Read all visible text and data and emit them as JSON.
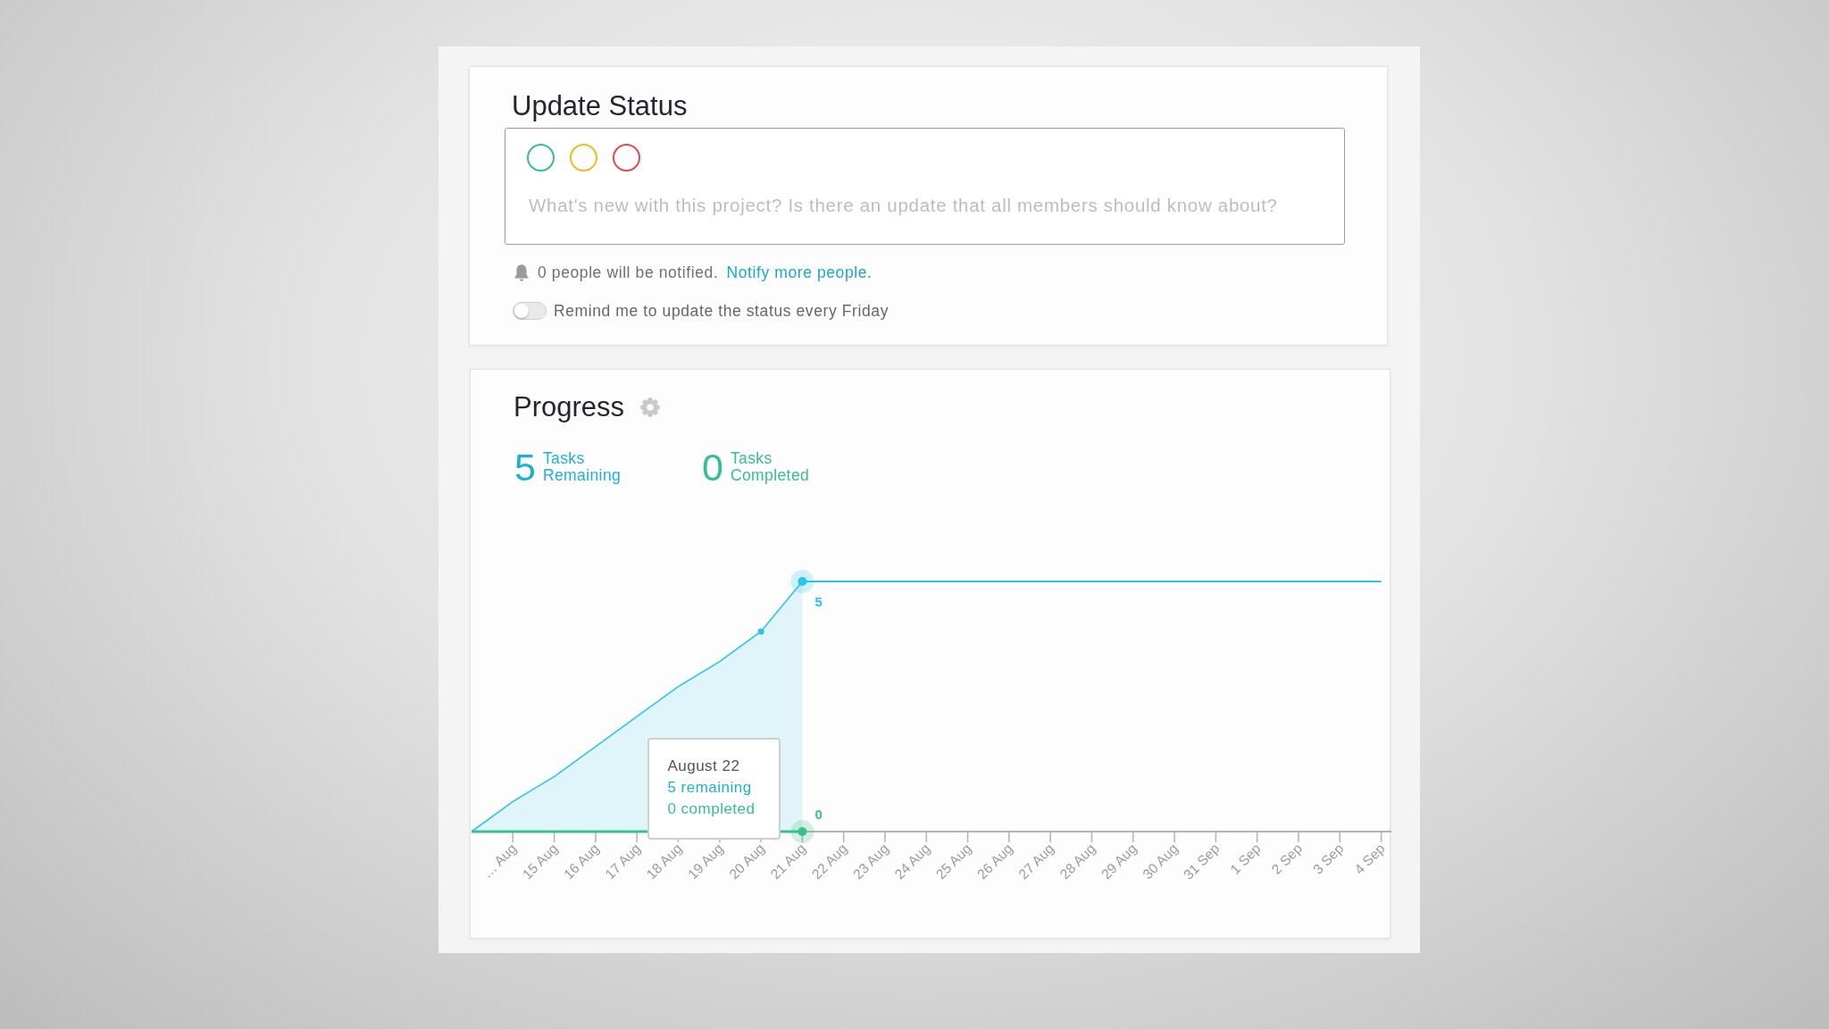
{
  "update_status": {
    "title": "Update Status",
    "status_options": [
      {
        "color": "#33c08f",
        "selected": false
      },
      {
        "color": "#f4b821",
        "selected": false
      },
      {
        "color": "#e8474f",
        "selected": false
      }
    ],
    "placeholder": "What's new with this project? Is there an update that all members should know about?",
    "notification": {
      "text": "0 people will be notified.",
      "link": "Notify more people."
    },
    "reminder": {
      "label": "Remind me to update the status every Friday",
      "on": false
    }
  },
  "progress": {
    "title": "Progress",
    "stats": [
      {
        "value": "5",
        "label": "Tasks Remaining",
        "color": "#1eb0d4"
      },
      {
        "value": "0",
        "label": "Tasks Completed",
        "color": "#36bf8c"
      }
    ],
    "chart": {
      "x_labels": [
        "… Aug",
        "15 Aug",
        "16 Aug",
        "17 Aug",
        "18 Aug",
        "19 Aug",
        "20 Aug",
        "21 Aug",
        "22 Aug",
        "23 Aug",
        "24 Aug",
        "25 Aug",
        "26 Aug",
        "27 Aug",
        "28 Aug",
        "29 Aug",
        "30 Aug",
        "31 Sep",
        "1 Sep",
        "2 Sep",
        "3 Sep",
        "4 Sep"
      ],
      "point_labels": [
        "5",
        "0"
      ]
    },
    "tooltip": {
      "title": "August 22",
      "lines": [
        {
          "text": "5 remaining",
          "color": "#1eb0d4"
        },
        {
          "text": "0 completed",
          "color": "#36bf8c"
        }
      ]
    }
  }
}
